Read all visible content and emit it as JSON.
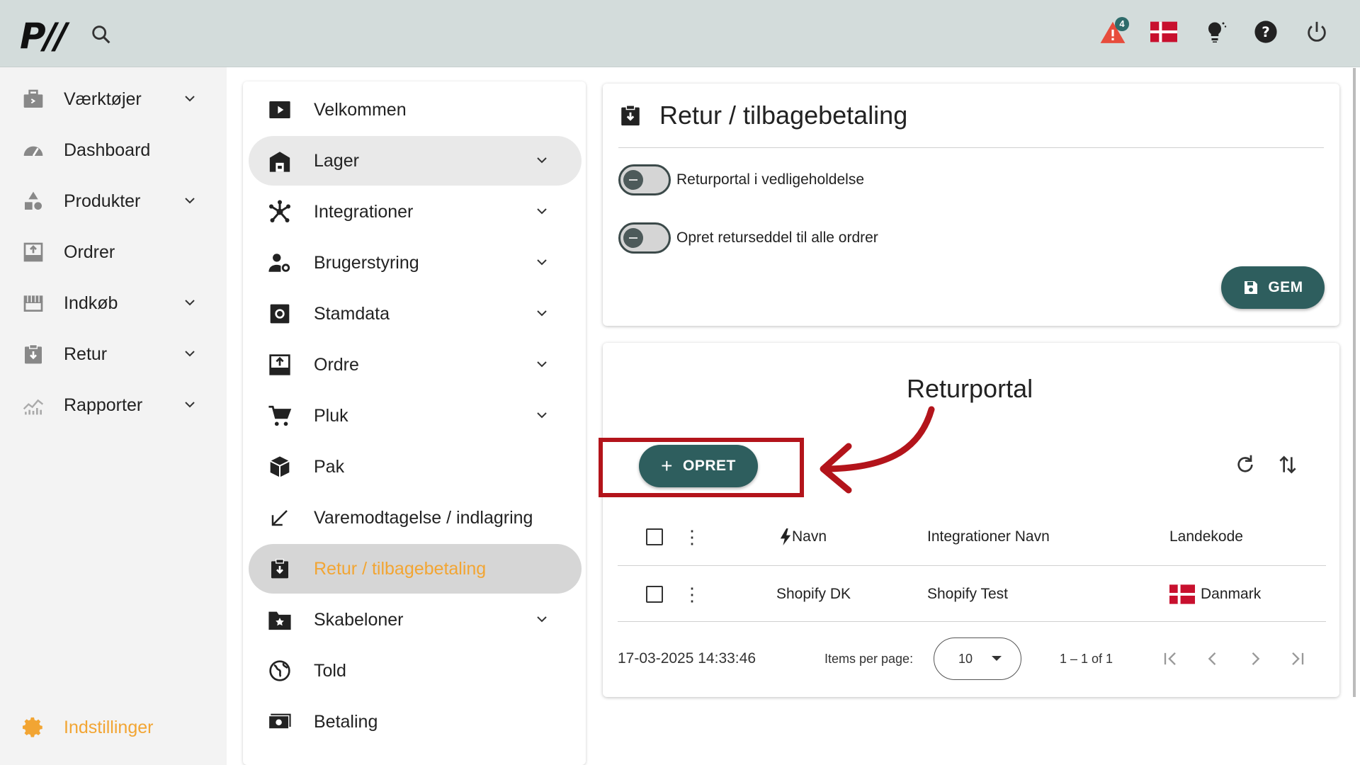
{
  "header": {
    "logo_text": "P//",
    "notification_count": "4",
    "icons": [
      "search-icon",
      "warning-icon",
      "danish-flag-icon",
      "lightbulb-icon",
      "help-icon",
      "power-icon"
    ]
  },
  "sidebar": {
    "items": [
      {
        "label": "Værktøjer",
        "icon": "toolbox-icon",
        "expandable": true
      },
      {
        "label": "Dashboard",
        "icon": "speedometer-icon",
        "expandable": false
      },
      {
        "label": "Produkter",
        "icon": "shapes-icon",
        "expandable": true
      },
      {
        "label": "Ordrer",
        "icon": "inbox-icon",
        "expandable": false
      },
      {
        "label": "Indkøb",
        "icon": "store-icon",
        "expandable": true
      },
      {
        "label": "Retur",
        "icon": "clipboard-return-icon",
        "expandable": true
      },
      {
        "label": "Rapporter",
        "icon": "chart-icon",
        "expandable": true
      }
    ],
    "settings_label": "Indstillinger"
  },
  "submenu": {
    "items": [
      {
        "label": "Velkommen",
        "icon": "play-icon",
        "expandable": false
      },
      {
        "label": "Lager",
        "icon": "warehouse-icon",
        "expandable": true
      },
      {
        "label": "Integrationer",
        "icon": "hub-icon",
        "expandable": true
      },
      {
        "label": "Brugerstyring",
        "icon": "user-settings-icon",
        "expandable": true
      },
      {
        "label": "Stamdata",
        "icon": "settings-box-icon",
        "expandable": true
      },
      {
        "label": "Ordre",
        "icon": "inbox-arrow-icon",
        "expandable": true
      },
      {
        "label": "Pluk",
        "icon": "cart-icon",
        "expandable": true
      },
      {
        "label": "Pak",
        "icon": "package-icon",
        "expandable": false
      },
      {
        "label": "Varemodtagelse / indlagring",
        "icon": "arrow-down-left-icon",
        "expandable": false
      },
      {
        "label": "Retur / tilbagebetaling",
        "icon": "clipboard-return-icon",
        "expandable": false
      },
      {
        "label": "Skabeloner",
        "icon": "folder-star-icon",
        "expandable": true
      },
      {
        "label": "Told",
        "icon": "globe-icon",
        "expandable": false
      },
      {
        "label": "Betaling",
        "icon": "cash-icon",
        "expandable": false
      }
    ]
  },
  "settings_card": {
    "title": "Retur / tilbagebetaling",
    "toggles": [
      {
        "label": "Returportal i vedligeholdelse",
        "on": false
      },
      {
        "label": "Opret returseddel til alle ordrer",
        "on": false
      }
    ],
    "save_label": "GEM"
  },
  "portal_card": {
    "annotation_label": "Returportal",
    "create_label": "OPRET",
    "columns": [
      "Navn",
      "Integrationer Navn",
      "Landekode"
    ],
    "rows": [
      {
        "navn": "Shopify DK",
        "integration": "Shopify Test",
        "country": "Danmark"
      }
    ],
    "timestamp": "17-03-2025 14:33:46",
    "items_per_page_label": "Items per page:",
    "items_per_page": "10",
    "range": "1 – 1 of 1"
  },
  "colors": {
    "accent": "#2e5e5e",
    "active_text": "#f2a533",
    "annotation_red": "#b3141b",
    "topbar": "#d3dcdb"
  }
}
